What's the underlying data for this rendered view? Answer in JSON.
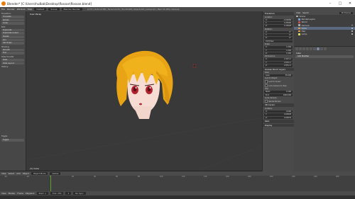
{
  "window": {
    "title": "Blender* [C:\\Users\\hu8ab\\Desktop\\flossan\\flossan.blend]",
    "minimize": "–",
    "maximize": "□",
    "close": "✕"
  },
  "menubar": {
    "items": [
      "File",
      "Render",
      "Window",
      "Help"
    ],
    "layout": "Default",
    "scene": "Scene",
    "engine": "Blender Render",
    "stats": "v2.79 | Verts:14,580 | Faces:14,234 | Tris:28,468 | Objects:0/4 | Lamps:0/1 | Mem:53.22M | Cameras"
  },
  "left_panel": {
    "transform": "Transform:",
    "translate": "Translate",
    "rotate": "Rotate",
    "scale": "Scale",
    "edit_header": "Edit:",
    "duplicate": "Duplicate",
    "duplicate_linked": "Duplicate Linked",
    "delete": "Delete",
    "join": "Join",
    "set_origin": "Set Origin",
    "shading_header": "Shading:",
    "smooth": "Smooth",
    "flat": "Flat",
    "data_transfer_header": "Data Transfer:",
    "data": "Data",
    "data_layout": "Data Layout",
    "history_header": "History:",
    "toggle_label": "Toggle",
    "toggle_value": "Toggle"
  },
  "viewport": {
    "label": "User Persp",
    "object_label": "(1) Cube"
  },
  "n_panel": {
    "transform_header": "Transform",
    "location_label": "Location:",
    "location": [
      [
        "X:",
        "-0.00089"
      ],
      [
        "Y:",
        "0.25066"
      ],
      [
        "Z:",
        "0.13628"
      ]
    ],
    "rotation_label": "Rotation:",
    "rotation": [
      [
        "X:",
        "0°"
      ],
      [
        "Y:",
        "0°"
      ],
      [
        "Z:",
        "0°"
      ]
    ],
    "rotation_mode": "XYZ Euler",
    "scale_label": "Scale:",
    "scale": [
      [
        "X:",
        "1.000"
      ],
      [
        "Y:",
        "1.000"
      ],
      [
        "Z:",
        "1.000"
      ]
    ],
    "dimensions_label": "Dimensions:",
    "dimensions": [
      [
        "X:",
        "2.307 m"
      ],
      [
        "Y:",
        "2.054 m"
      ],
      [
        "Z:",
        "2.051 m"
      ]
    ],
    "grease_pencil_header": "Grease Pencil Layers",
    "scene_label": "Scene",
    "object_label": "Object",
    "new": "New",
    "new_layer": "New Layer",
    "view_header": "View",
    "lens_label": "Lens:",
    "lens_value": "35.000",
    "lock_object": "Lock to Object:",
    "lock_cursor": "Lock to Cursor",
    "lock_camera": "Lock Camera to View",
    "clip_label": "Clip:",
    "clip_start": [
      "Start:",
      "0.100"
    ],
    "clip_end": [
      "End:",
      "1000.000"
    ],
    "local_camera": "Local Camera:",
    "render_border": "Render Border",
    "cursor_header": "3D Cursor",
    "cursor_location": "Location:",
    "cursor": [
      [
        "X:",
        "0.000"
      ],
      [
        "Y:",
        "0.00028"
      ],
      [
        "Z:",
        "0.00079"
      ]
    ],
    "item_header": "Item",
    "display_header": "Display"
  },
  "outliner": {
    "header_view": "View",
    "header_search": "Search",
    "scene_select": "All Scenes",
    "rows": [
      {
        "label": "Scene",
        "color": "#b0b0b0"
      },
      {
        "label": "RenderLayers",
        "color": "#7a9fd0"
      },
      {
        "label": "World",
        "color": "#c05050"
      },
      {
        "label": "Camera",
        "color": "#aaaaaa"
      },
      {
        "label": "Cube",
        "color": "#e89a3c"
      },
      {
        "label": "Hair",
        "color": "#e89a3c"
      },
      {
        "label": "Lamp",
        "color": "#dddd66"
      }
    ]
  },
  "properties": {
    "object_name": "Cube",
    "add_modifier": "Add Modifier"
  },
  "timeline": {
    "menu": [
      "View",
      "Marker",
      "Frame",
      "Playback"
    ],
    "start_label": "Start: 1",
    "end_label": "End: 250",
    "current": "1",
    "sync": "No Sync",
    "ruler": [
      "-40",
      "-20",
      "0",
      "20",
      "40",
      "60",
      "80",
      "100",
      "120",
      "140",
      "160",
      "180",
      "200",
      "220",
      "240",
      "260"
    ]
  },
  "viewport_header": {
    "view": "View",
    "select": "Select",
    "add": "Add",
    "object": "Object",
    "mode": "Object Mode",
    "pivot": "Global"
  }
}
